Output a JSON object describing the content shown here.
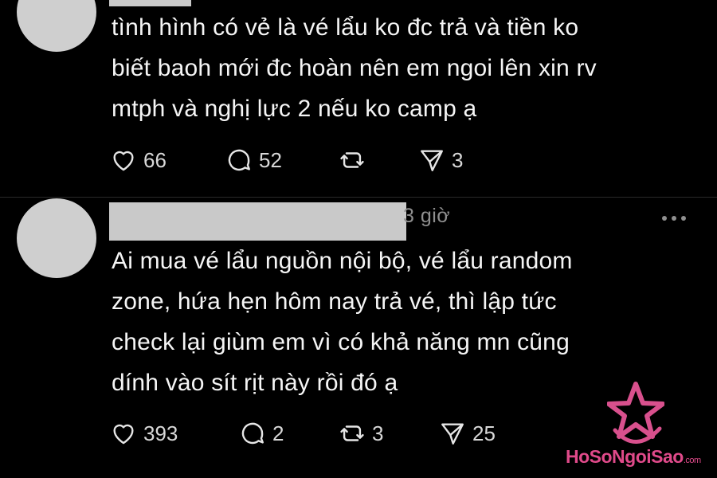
{
  "posts": [
    {
      "time": "",
      "lines": [
        "tình hình có vẻ là vé lẩu ko đc trả và tiền ko",
        "biết baoh mới đc hoàn nên em ngoi lên xin rv",
        "mtph và nghị lực 2 nếu ko camp ạ"
      ],
      "likes": "66",
      "replies": "52",
      "reposts": "",
      "shares": "3"
    },
    {
      "time": "3 giờ",
      "lines": [
        "Ai mua vé lẩu nguồn nội bộ, vé lẩu random",
        "zone, hứa hẹn hôm nay trả vé, thì lập tức",
        "check lại giùm em vì có khả năng mn cũng",
        "dính vào sít rịt này rồi đó ạ"
      ],
      "likes": "393",
      "replies": "2",
      "reposts": "3",
      "shares": "25"
    }
  ],
  "watermark": {
    "brand": "HoSoNgoiSao",
    "suffix": ".com",
    "color": "#e04a8a"
  },
  "icons": [
    "heart-icon",
    "comment-icon",
    "repost-icon",
    "share-icon",
    "more-icon",
    "star-logo-icon"
  ]
}
